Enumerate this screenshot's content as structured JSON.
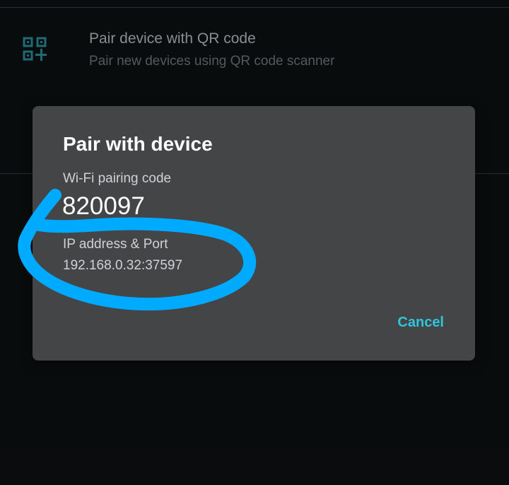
{
  "settings": {
    "qr_row": {
      "title": "Pair device with QR code",
      "subtitle": "Pair new devices using QR code scanner",
      "icon": "qr-code-add-icon"
    }
  },
  "dialog": {
    "title": "Pair with device",
    "code_label": "Wi-Fi pairing code",
    "code_value": "820097",
    "ip_label": "IP address & Port",
    "ip_value": "192.168.0.32:37597",
    "cancel_label": "Cancel"
  },
  "colors": {
    "background": "#0d1012",
    "dialog": "#444546",
    "accent": "#2ec5dd",
    "annotation": "#00aaff",
    "icon": "#2a8f9a"
  }
}
